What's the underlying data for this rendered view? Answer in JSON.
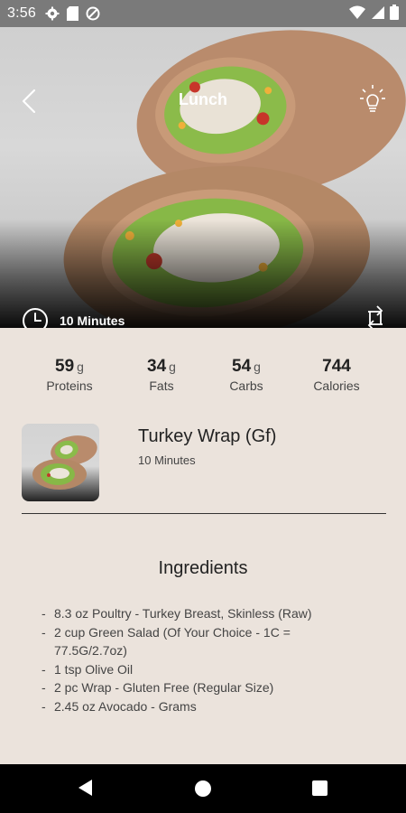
{
  "status_bar": {
    "time": "3:56"
  },
  "hero": {
    "title": "Lunch",
    "prep_time": "10 Minutes"
  },
  "macros": [
    {
      "value": "59",
      "unit": "g",
      "label": "Proteins"
    },
    {
      "value": "34",
      "unit": "g",
      "label": "Fats"
    },
    {
      "value": "54",
      "unit": "g",
      "label": "Carbs"
    },
    {
      "value": "744",
      "unit": "",
      "label": "Calories"
    }
  ],
  "recipe": {
    "title": "Turkey Wrap (Gf)",
    "time": "10 Minutes"
  },
  "ingredients": {
    "heading": "Ingredients",
    "items": [
      "8.3 oz Poultry - Turkey Breast, Skinless (Raw)",
      "2 cup Green Salad (Of Your Choice - 1C = 77.5G/2.7oz)",
      "1 tsp Olive Oil",
      "2 pc Wrap - Gluten Free (Regular Size)",
      "2.45 oz Avocado - Grams"
    ]
  },
  "colors": {
    "background": "#ebe3dc",
    "status_bar": "#7a7a7a",
    "nav_bar": "#000000",
    "text_primary": "#222222"
  }
}
